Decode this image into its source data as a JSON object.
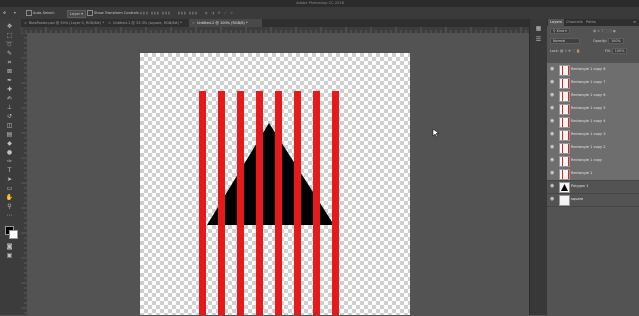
{
  "app": {
    "title": "Adobe Photoshop CC 2018"
  },
  "options_bar": {
    "auto_select_label": "Auto-Select:",
    "auto_select_value": "Layer",
    "transform_label": "Show Transform Controls"
  },
  "tabs": [
    {
      "label": "BlobPoster.psd @ 50% (Layer 0, RGB/8#) *",
      "active": false
    },
    {
      "label": "Untitled-1 @ 33.3% (square, RGB/8#) *",
      "active": false
    },
    {
      "label": "Untitled-2 @ 100% (RGB/8) *",
      "active": true
    }
  ],
  "panel": {
    "tabs": [
      {
        "label": "Layers",
        "active": true
      },
      {
        "label": "Channels",
        "active": false
      },
      {
        "label": "Paths",
        "active": false
      }
    ],
    "kind_label": "Kind",
    "blend_mode": "Normal",
    "opacity_label": "Opacity:",
    "opacity_value": "100%",
    "lock_label": "Lock:",
    "fill_label": "Fill:",
    "fill_value": "100%",
    "layers": [
      {
        "name": "Rectangle 1 copy 8",
        "type": "rect",
        "visible": true,
        "selected": true
      },
      {
        "name": "Rectangle 1 copy 7",
        "type": "rect",
        "visible": true,
        "selected": true
      },
      {
        "name": "Rectangle 1 copy 6",
        "type": "rect",
        "visible": true,
        "selected": true
      },
      {
        "name": "Rectangle 1 copy 5",
        "type": "rect",
        "visible": true,
        "selected": true
      },
      {
        "name": "Rectangle 1 copy 4",
        "type": "rect",
        "visible": true,
        "selected": true
      },
      {
        "name": "Rectangle 1 copy 3",
        "type": "rect",
        "visible": true,
        "selected": true
      },
      {
        "name": "Rectangle 1 copy 2",
        "type": "rect",
        "visible": true,
        "selected": true
      },
      {
        "name": "Rectangle 1 copy",
        "type": "rect",
        "visible": true,
        "selected": true
      },
      {
        "name": "Rectangle 1",
        "type": "rect",
        "visible": true,
        "selected": true
      },
      {
        "name": "Polygon 1",
        "type": "polygon",
        "visible": true,
        "selected": false
      },
      {
        "name": "square",
        "type": "plain",
        "visible": true,
        "selected": false
      }
    ]
  },
  "colors": {
    "stripe": "#e8191a",
    "triangle": "#000000",
    "foreground": "#000000",
    "background": "#ffffff"
  },
  "icons": {
    "move_tool": "move-tool-icon",
    "visibility": "eye-icon"
  }
}
